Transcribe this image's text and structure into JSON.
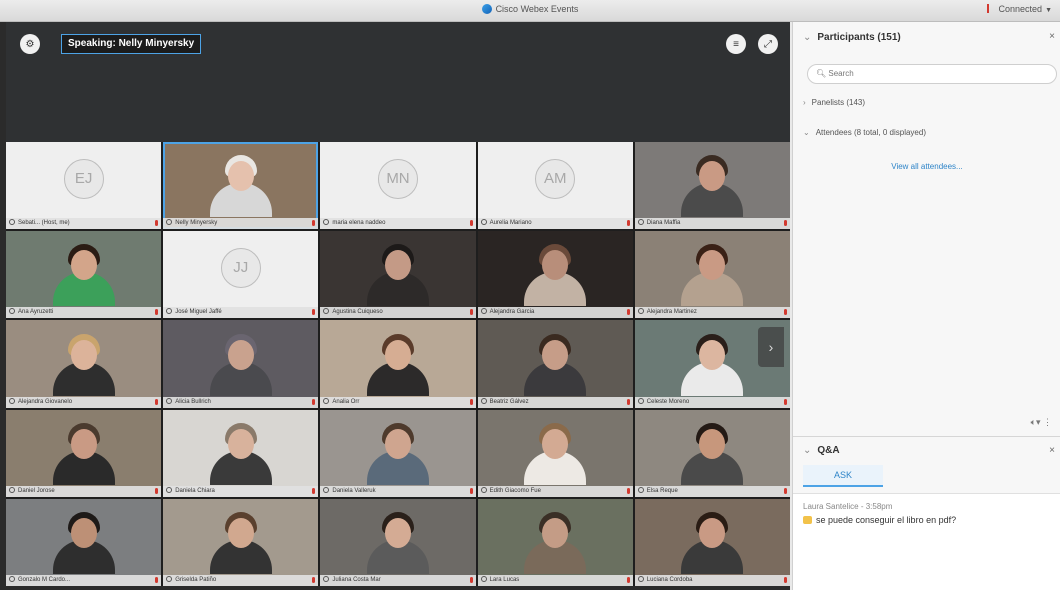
{
  "window": {
    "title": "Cisco Webex Events",
    "status": "Connected"
  },
  "stage": {
    "speaking_label": "Speaking: Nelly Minyersky",
    "participants": [
      {
        "name": "Sebati... (Host, me)",
        "initials": "EJ",
        "video": false
      },
      {
        "name": "Nelly Minyersky",
        "initials": "",
        "video": true,
        "active": true,
        "bg": "#8a7560",
        "skin": "#e5c1ad",
        "hair": "#e9e6e2",
        "top": "#d7d7d7"
      },
      {
        "name": "maria elena naddeo",
        "initials": "MN",
        "video": false
      },
      {
        "name": "Aurelia Mariano",
        "initials": "AM",
        "video": false
      },
      {
        "name": "Diana Maffia",
        "initials": "",
        "video": true,
        "bg": "#7d7a78",
        "skin": "#c99a84",
        "hair": "#3a2b22",
        "top": "#4b4b4b"
      },
      {
        "name": "Ana Ayruzetti",
        "initials": "",
        "video": true,
        "bg": "#6f7b70",
        "skin": "#d3a58a",
        "hair": "#2b1c14",
        "top": "#3ca05a"
      },
      {
        "name": "José Miguel Jaffé",
        "initials": "JJ",
        "video": false
      },
      {
        "name": "Agustina Cuiqueso",
        "initials": "",
        "video": true,
        "bg": "#3a3533",
        "skin": "#c49a86",
        "hair": "#1d1a19",
        "top": "#2d2a29"
      },
      {
        "name": "Alejandra Garcia",
        "initials": "",
        "video": true,
        "bg": "#2a2523",
        "skin": "#b88e7a",
        "hair": "#6a4a3a",
        "top": "#c2b2a4"
      },
      {
        "name": "Alejandra Martinez",
        "initials": "",
        "video": true,
        "bg": "#8b8176",
        "skin": "#c99a84",
        "hair": "#3a2116",
        "top": "#b4a18f"
      },
      {
        "name": "Alejandra Giovanelo",
        "initials": "",
        "video": true,
        "bg": "#9a8d80",
        "skin": "#dcb39a",
        "hair": "#c9a46d",
        "top": "#2e2e2e"
      },
      {
        "name": "Alicia Bullrich",
        "initials": "",
        "video": true,
        "bg": "#5e5b61",
        "skin": "#c9a28e",
        "hair": "#6a6570",
        "top": "#4a4a4e"
      },
      {
        "name": "Analia Orr",
        "initials": "",
        "video": true,
        "bg": "#b8a896",
        "skin": "#d6ad93",
        "hair": "#5a3b2a",
        "top": "#2c2a2a"
      },
      {
        "name": "Beatriz Gálvez",
        "initials": "",
        "video": true,
        "bg": "#5f5a54",
        "skin": "#c69d88",
        "hair": "#3a2a20",
        "top": "#3b3a3d"
      },
      {
        "name": "Celeste Moreno",
        "initials": "",
        "video": true,
        "bg": "#6b7a75",
        "skin": "#dcb6a0",
        "hair": "#2a1f1a",
        "top": "#eaeaea"
      },
      {
        "name": "Daniel Jorose",
        "initials": "",
        "video": true,
        "bg": "#8a7e6e",
        "skin": "#c99a84",
        "hair": "#4a3a2e",
        "top": "#2a2a2a"
      },
      {
        "name": "Daniela Chiara",
        "initials": "",
        "video": true,
        "bg": "#d8d6d2",
        "skin": "#d8b29c",
        "hair": "#8a7a6a",
        "top": "#3a3a3a"
      },
      {
        "name": "Daniela Valleruk",
        "initials": "",
        "video": true,
        "bg": "#9a9590",
        "skin": "#cfa58f",
        "hair": "#4e3a2c",
        "top": "#5a6a7a"
      },
      {
        "name": "Edith Giacomo Fue",
        "initials": "",
        "video": true,
        "bg": "#7a756d",
        "skin": "#d3aa93",
        "hair": "#8a6a4a",
        "top": "#ede9e4"
      },
      {
        "name": "Elsa Reque",
        "initials": "",
        "video": true,
        "bg": "#8e8880",
        "skin": "#c7977c",
        "hair": "#241a15",
        "top": "#4a4a4a"
      },
      {
        "name": "Gonzalo M Cardo...",
        "initials": "",
        "video": true,
        "bg": "#7c7e80",
        "skin": "#bd9076",
        "hair": "#1e1a18",
        "top": "#2e2e2e"
      },
      {
        "name": "Griselda Patiño",
        "initials": "",
        "video": true,
        "bg": "#a39a8e",
        "skin": "#d1a88f",
        "hair": "#5a402e",
        "top": "#333"
      },
      {
        "name": "Juliana Costa Mar",
        "initials": "",
        "video": true,
        "bg": "#6d6a66",
        "skin": "#d4ab94",
        "hair": "#2a201a",
        "top": "#5b5b5b"
      },
      {
        "name": "Lara Lucas",
        "initials": "",
        "video": true,
        "bg": "#6a7060",
        "skin": "#c49c86",
        "hair": "#3a2f26",
        "top": "#7a6a5a"
      },
      {
        "name": "Luciana Cordoba",
        "initials": "",
        "video": true,
        "bg": "#7a6b5e",
        "skin": "#c99a84",
        "hair": "#2a1c14",
        "top": "#3a3a3a"
      }
    ]
  },
  "panel": {
    "participants_title": "Participants (151)",
    "search_placeholder": "Search",
    "panelists_label": "Panelists (143)",
    "attendees_label": "Attendees (8 total, 0 displayed)",
    "view_all_label": "View all attendees...",
    "qa_title": "Q&A",
    "qa_tab_label": "ASK",
    "qa_author": "Laura Santelice - 3:58pm",
    "qa_question": "se puede conseguir el libro en pdf?"
  }
}
